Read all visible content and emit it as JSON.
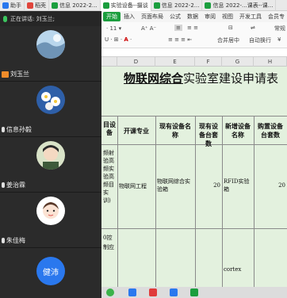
{
  "tabs": [
    {
      "label": "助手",
      "color": "#2a78ee"
    },
    {
      "label": "稻壳",
      "color": "#e0453c"
    },
    {
      "label": "信息 2022-2...",
      "color": "#1b9e3e"
    },
    {
      "label": "实验设备--摄谈",
      "color": "#1b9e3e"
    },
    {
      "label": "信息 2022-2...",
      "color": "#1b9e3e"
    },
    {
      "label": "信息 2022-...课表--课...",
      "color": "#1b9e3e"
    }
  ],
  "meeting": {
    "speaking_label": "正在讲话: 刘玉兰;",
    "participants": [
      {
        "name": "刘玉兰",
        "host": true
      },
      {
        "name": "信息孙毅",
        "host": false
      },
      {
        "name": "姜治霖",
        "host": false
      },
      {
        "name": "朱佳梅",
        "host": false
      }
    ],
    "bottom_avatar_text": "健沛"
  },
  "sheet": {
    "menu": [
      "开始",
      "插入",
      "页面布局",
      "公式",
      "数据",
      "审阅",
      "视图",
      "开发工具",
      "会员专"
    ],
    "ribbon": {
      "font_size": "11",
      "merge_label": "合并居中",
      "wrap_label": "自动换行",
      "format_label": "常规",
      "currency": "¥"
    },
    "columns": [
      "D",
      "E",
      "F",
      "G",
      "H"
    ],
    "title_underlined": "物联网综合",
    "title_rest": "实验室建设申请表",
    "headers": [
      "目设备",
      "开课专业",
      "现有设备名称",
      "现有设备台套数",
      "新增设备名称",
      "购置设备台套数"
    ],
    "row1": {
      "d_text": "频射验高频实验高频目实训)",
      "major": "物联网工程",
      "existing_name": "物联网综合实验箱",
      "existing_count": "20",
      "new_name": "RFID实验箱",
      "new_count": "20"
    },
    "row2": {
      "d_text": "0控制应",
      "new_name": "cortex"
    }
  }
}
